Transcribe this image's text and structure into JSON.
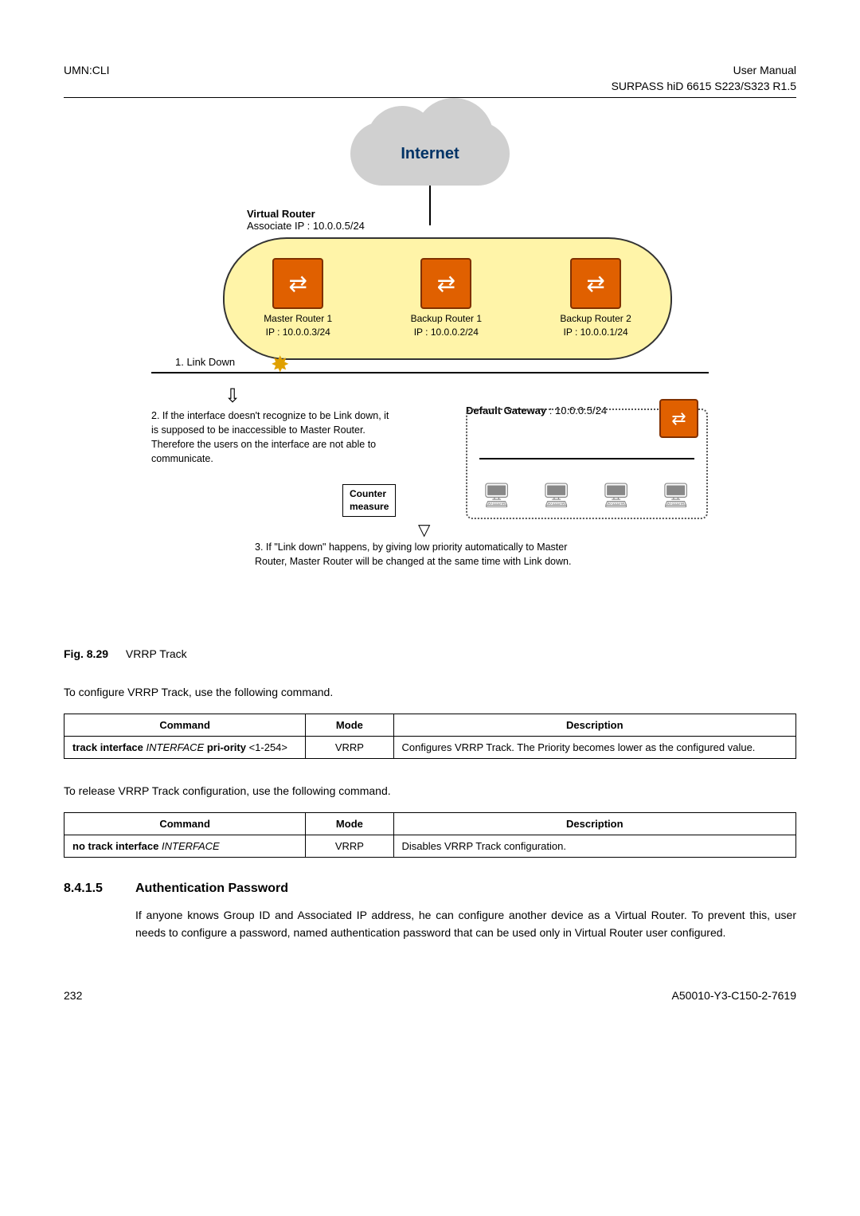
{
  "header": {
    "left": "UMN:CLI",
    "right_line1": "User Manual",
    "right_line2": "SURPASS hiD 6615 S223/S323 R1.5"
  },
  "diagram": {
    "cloud": "Internet",
    "vr_label_b": "Virtual Router",
    "vr_label": "Associate IP : 10.0.0.5/24",
    "routers": [
      {
        "name": "Master Router 1",
        "ip": "IP : 10.0.0.3/24"
      },
      {
        "name": "Backup Router 1",
        "ip": "IP : 10.0.0.2/24"
      },
      {
        "name": "Backup Router 2",
        "ip": "IP : 10.0.0.1/24"
      }
    ],
    "linkdown": "1. Link Down",
    "note2": "2. If the interface doesn't recognize to be Link down, it is supposed to be inaccessible to Master Router. Therefore the users on the interface are not able to communicate.",
    "gateway_b": "Default Gateway",
    "gateway_rest": ": 10.0.0.5/24",
    "counter_l1": "Counter",
    "counter_l2": "measure",
    "note3": "3. If \"Link down\" happens, by giving low priority automatically to Master Router, Master Router will be changed at the same time with Link down."
  },
  "fig": {
    "num": "Fig. 8.29",
    "caption": "VRRP Track"
  },
  "para1": "To configure VRRP Track, use the following command.",
  "table1": {
    "h1": "Command",
    "h2": "Mode",
    "h3": "Description",
    "cmd_a": "track interface ",
    "cmd_b": "INTERFACE",
    "cmd_c": " pri-ority ",
    "cmd_d": "<1-254>",
    "mode": "VRRP",
    "desc": "Configures VRRP Track. The Priority becomes lower as the configured value."
  },
  "para2": "To release VRRP Track configuration, use the following command.",
  "table2": {
    "h1": "Command",
    "h2": "Mode",
    "h3": "Description",
    "cmd_a": "no track interface ",
    "cmd_b": "INTERFACE",
    "mode": "VRRP",
    "desc": "Disables VRRP Track configuration."
  },
  "section": {
    "num": "8.4.1.5",
    "title": "Authentication Password",
    "body": "If anyone knows Group ID and Associated IP address, he can configure another device as a Virtual Router. To prevent this, user needs to configure a password, named authentication password that can be used only in Virtual Router user configured."
  },
  "footer": {
    "left": "232",
    "right": "A50010-Y3-C150-2-7619"
  },
  "chart_data": {
    "type": "diagram",
    "title": "VRRP Track",
    "nodes": [
      {
        "id": "internet",
        "label": "Internet",
        "type": "cloud"
      },
      {
        "id": "virtual_router",
        "label": "Virtual Router",
        "associate_ip": "10.0.0.5/24",
        "type": "group"
      },
      {
        "id": "master_router_1",
        "label": "Master Router 1",
        "ip": "10.0.0.3/24",
        "type": "router",
        "parent": "virtual_router"
      },
      {
        "id": "backup_router_1",
        "label": "Backup Router 1",
        "ip": "10.0.0.2/24",
        "type": "router",
        "parent": "virtual_router"
      },
      {
        "id": "backup_router_2",
        "label": "Backup Router 2",
        "ip": "10.0.0.1/24",
        "type": "router",
        "parent": "virtual_router"
      },
      {
        "id": "default_gateway",
        "label": "Default Gateway",
        "ip": "10.0.0.5/24",
        "type": "router"
      },
      {
        "id": "lan",
        "label": "LAN segment",
        "type": "network",
        "host_count": 4
      }
    ],
    "edges": [
      {
        "from": "internet",
        "to": "virtual_router"
      },
      {
        "from": "master_router_1",
        "to": "link_down_bus"
      },
      {
        "from": "backup_router_1",
        "to": "link_down_bus"
      },
      {
        "from": "backup_router_2",
        "to": "link_down_bus"
      },
      {
        "from": "default_gateway",
        "to": "lan"
      }
    ],
    "annotations": [
      {
        "step": 1,
        "text": "Link Down",
        "at": "master_router_1 uplink"
      },
      {
        "step": 2,
        "text": "If the interface doesn't recognize to be Link down, it is supposed to be inaccessible to Master Router. Therefore the users on the interface are not able to communicate."
      },
      {
        "step": "counter_measure",
        "text": "Counter measure"
      },
      {
        "step": 3,
        "text": "If \"Link down\" happens, by giving low priority automatically to Master Router, Master Router will be changed at the same time with Link down."
      }
    ]
  }
}
